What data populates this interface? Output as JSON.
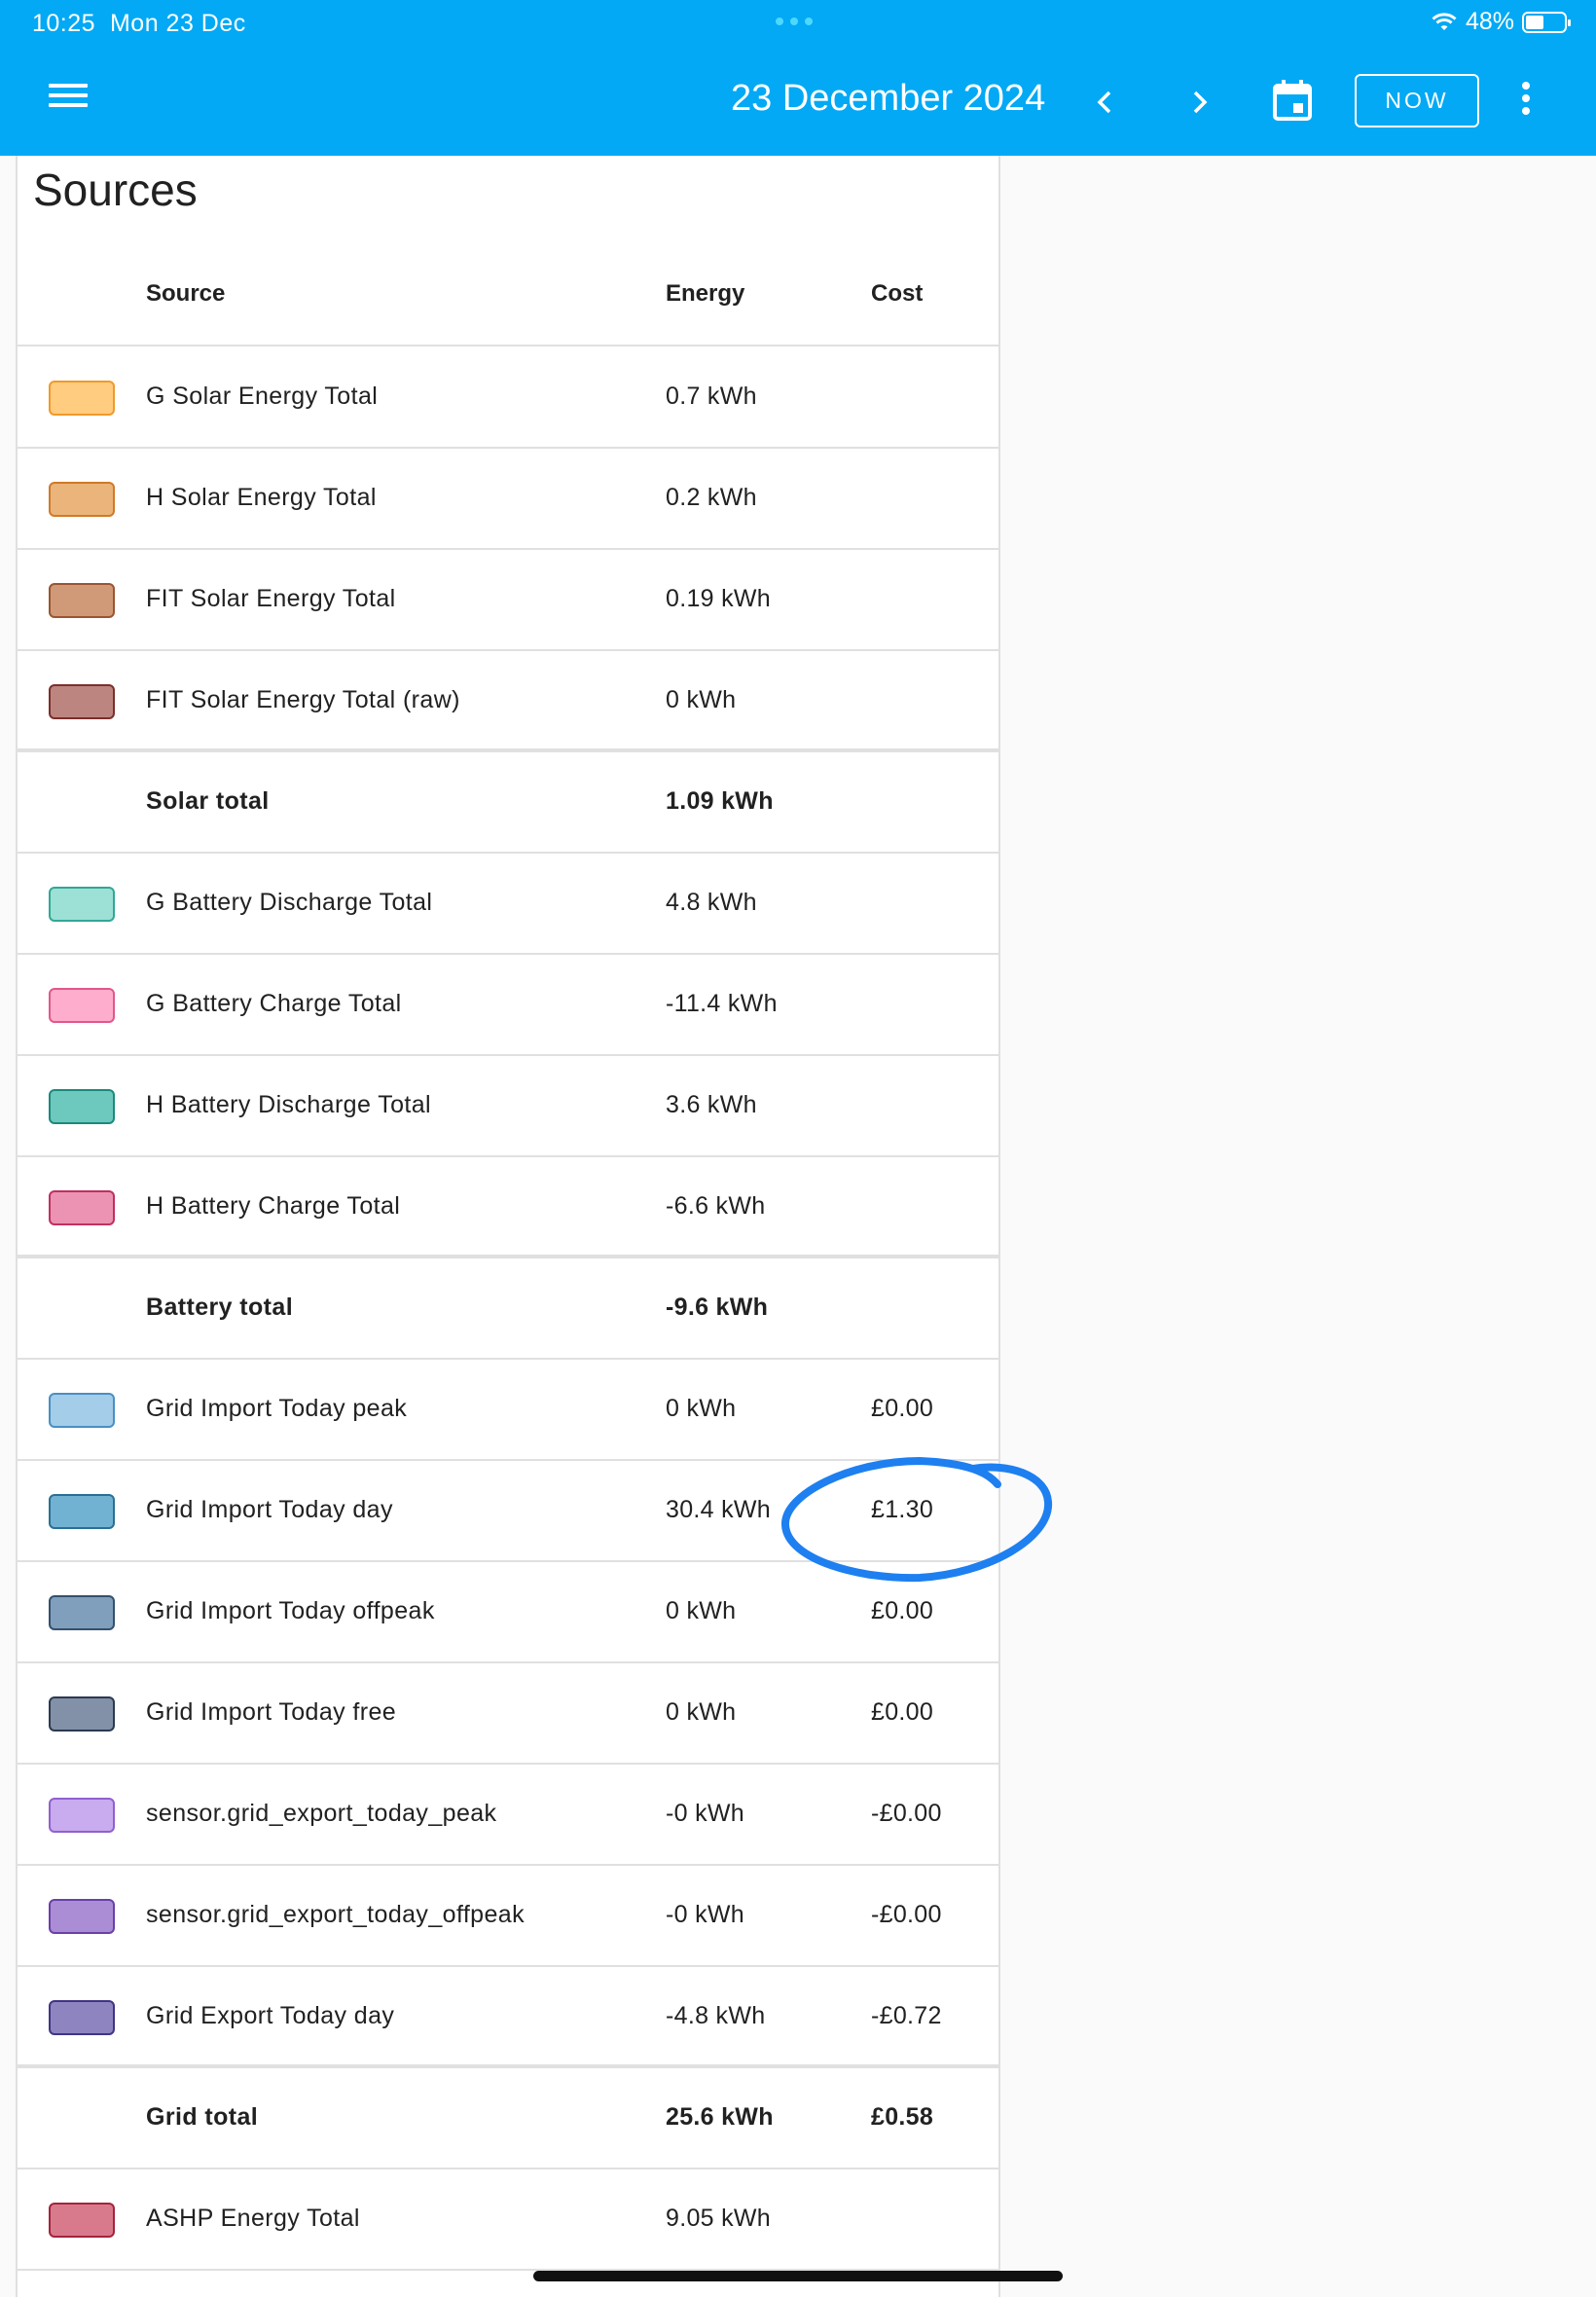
{
  "status_bar": {
    "time": "10:25",
    "date": "Mon 23 Dec",
    "battery": "48%"
  },
  "toolbar": {
    "date_title": "23 December 2024",
    "now_label": "NOW"
  },
  "card": {
    "title": "Sources",
    "headers": {
      "source": "Source",
      "energy": "Energy",
      "cost": "Cost"
    },
    "rows": [
      {
        "name": "G Solar Energy Total",
        "energy": "0.7 kWh",
        "cost": "",
        "swatch_fill": "#ffcc80",
        "swatch_border": "#f09a2a",
        "total": false
      },
      {
        "name": "H Solar Energy Total",
        "energy": "0.2 kWh",
        "cost": "",
        "swatch_fill": "#ebb47a",
        "swatch_border": "#d07a28",
        "total": false
      },
      {
        "name": "FIT Solar Energy Total",
        "energy": "0.19 kWh",
        "cost": "",
        "swatch_fill": "#d09a78",
        "swatch_border": "#9a5530",
        "total": false
      },
      {
        "name": "FIT Solar Energy Total (raw)",
        "energy": "0 kWh",
        "cost": "",
        "swatch_fill": "#bd8580",
        "swatch_border": "#7b2f2a",
        "total": false
      },
      {
        "name": "Solar total",
        "energy": "1.09 kWh",
        "cost": "",
        "total": true
      },
      {
        "name": "G Battery Discharge Total",
        "energy": "4.8 kWh",
        "cost": "",
        "swatch_fill": "#9de0d6",
        "swatch_border": "#31a896",
        "total": false
      },
      {
        "name": "G Battery Charge Total",
        "energy": "-11.4 kWh",
        "cost": "",
        "swatch_fill": "#ffadcc",
        "swatch_border": "#e0588a",
        "total": false
      },
      {
        "name": "H Battery Discharge Total",
        "energy": "3.6 kWh",
        "cost": "",
        "swatch_fill": "#6dc9bd",
        "swatch_border": "#1b8a7c",
        "total": false
      },
      {
        "name": "H Battery Charge Total",
        "energy": "-6.6 kWh",
        "cost": "",
        "swatch_fill": "#ec93b4",
        "swatch_border": "#c0305f",
        "total": false
      },
      {
        "name": "Battery total",
        "energy": "-9.6 kWh",
        "cost": "",
        "total": true
      },
      {
        "name": "Grid Import Today peak",
        "energy": "0 kWh",
        "cost": "£0.00",
        "swatch_fill": "#a3cde8",
        "swatch_border": "#4a8fc4",
        "total": false
      },
      {
        "name": "Grid Import Today day",
        "energy": "30.4 kWh",
        "cost": "£1.30",
        "swatch_fill": "#71b2d2",
        "swatch_border": "#2a6f95",
        "total": false
      },
      {
        "name": "Grid Import Today offpeak",
        "energy": "0 kWh",
        "cost": "£0.00",
        "swatch_fill": "#7f9fbd",
        "swatch_border": "#34506e",
        "total": false
      },
      {
        "name": "Grid Import Today free",
        "energy": "0 kWh",
        "cost": "£0.00",
        "swatch_fill": "#8290a8",
        "swatch_border": "#2c3a50",
        "total": false
      },
      {
        "name": "sensor.grid_export_today_peak",
        "energy": "-0 kWh",
        "cost": "-£0.00",
        "swatch_fill": "#c9abef",
        "swatch_border": "#9060d0",
        "total": false
      },
      {
        "name": "sensor.grid_export_today_offpeak",
        "energy": "-0 kWh",
        "cost": "-£0.00",
        "swatch_fill": "#ab8dd6",
        "swatch_border": "#6a40a8",
        "total": false
      },
      {
        "name": "Grid Export Today day",
        "energy": "-4.8 kWh",
        "cost": "-£0.72",
        "swatch_fill": "#8e84c0",
        "swatch_border": "#3f3585",
        "total": false
      },
      {
        "name": "Grid total",
        "energy": "25.6 kWh",
        "cost": "£0.58",
        "total": true
      },
      {
        "name": "ASHP Energy Total",
        "energy": "9.05 kWh",
        "cost": "",
        "swatch_fill": "#d97a8c",
        "swatch_border": "#a3243c",
        "total": false
      }
    ]
  }
}
